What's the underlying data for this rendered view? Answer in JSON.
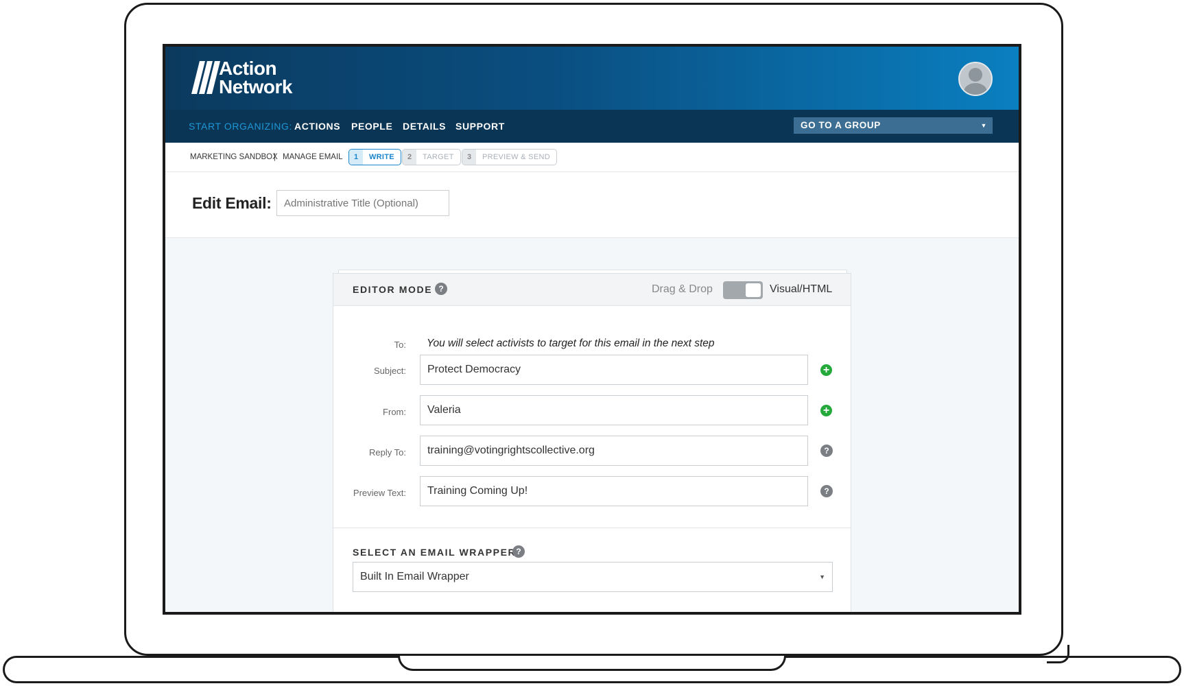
{
  "brand": {
    "line1": "Action",
    "line2": "Network"
  },
  "nav": {
    "start_label": "START ORGANIZING:",
    "items": [
      "ACTIONS",
      "PEOPLE",
      "DETAILS",
      "SUPPORT"
    ],
    "group_select": "GO TO A GROUP"
  },
  "breadcrumb": {
    "group": "MARKETING SANDBOX",
    "separator": "|",
    "section": "MANAGE EMAIL",
    "steps": [
      {
        "num": "1",
        "label": "WRITE",
        "active": true
      },
      {
        "num": "2",
        "label": "TARGET",
        "active": false
      },
      {
        "num": "3",
        "label": "PREVIEW & SEND",
        "active": false
      }
    ]
  },
  "page": {
    "title": "Edit Email:",
    "admin_title_placeholder": "Administrative Title (Optional)"
  },
  "editor": {
    "title": "EDITOR MODE",
    "help": "?",
    "mode_left": "Drag & Drop",
    "mode_right": "Visual/HTML",
    "mode_selected": "Visual/HTML"
  },
  "form": {
    "to_label": "To:",
    "to_text": "You will select activists to target for this email in the next step",
    "subject_label": "Subject:",
    "subject_value": "Protect Democracy",
    "from_label": "From:",
    "from_value": "Valeria",
    "reply_label": "Reply To:",
    "reply_value": "training@votingrightscollective.org",
    "preview_label": "Preview Text:",
    "preview_value": "Training Coming Up!"
  },
  "wrapper": {
    "title": "SELECT AN EMAIL WRAPPER",
    "selected": "Built In Email Wrapper"
  },
  "colors": {
    "header_dark": "#0b3a5e",
    "header_light": "#0a7fc0",
    "accent": "#1a86cb",
    "add_green": "#25a93b"
  },
  "icons": {
    "logo": "action-network-logo",
    "avatar": "user-avatar-icon",
    "add": "plus-circle-icon",
    "help": "question-circle-icon",
    "dropdown": "caret-down-icon"
  }
}
